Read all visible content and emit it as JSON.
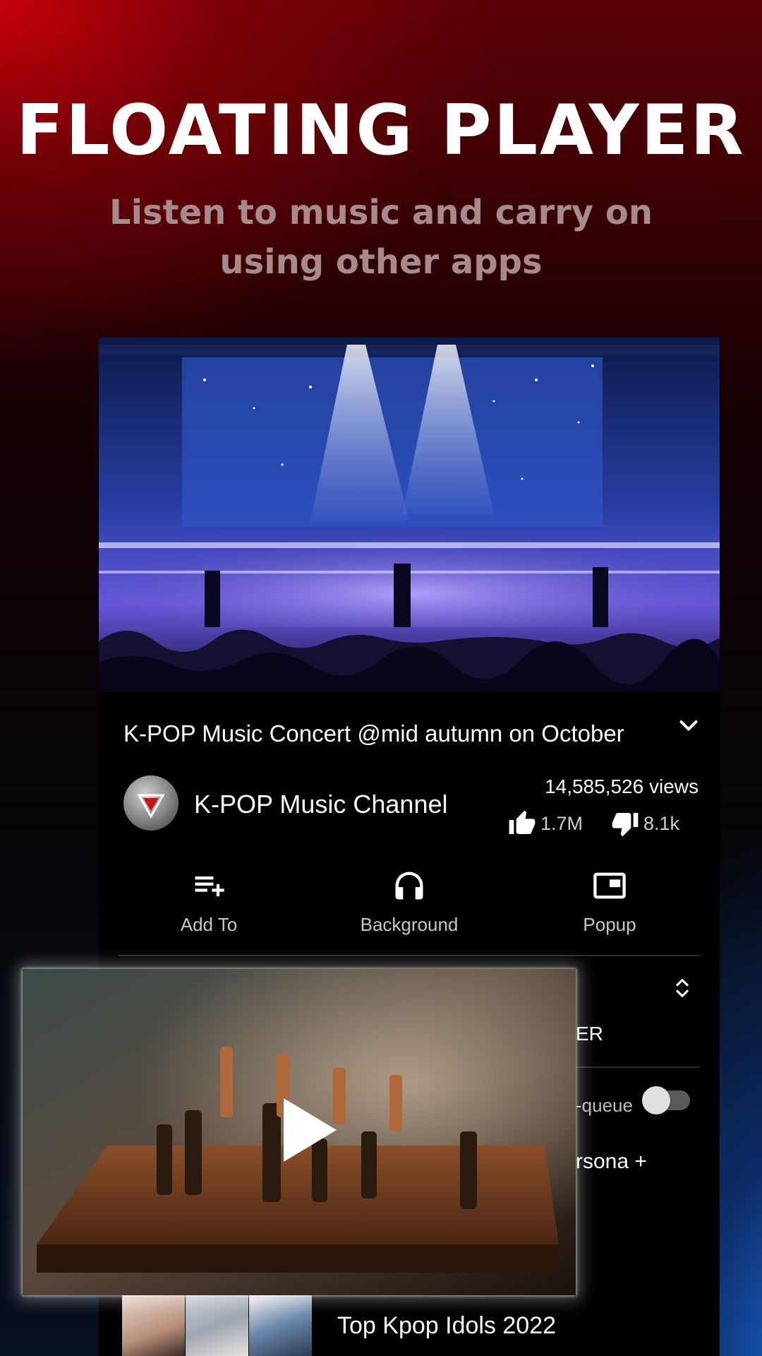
{
  "promo": {
    "title": "FLOATING PLAYER",
    "subtitle": "Listen to music and carry on using other apps"
  },
  "video": {
    "title": "K-POP Music Concert @mid autumn on October",
    "channel": "K-POP Music Channel",
    "views": "14,585,526 views",
    "likes": "1.7M",
    "dislikes": "8.1k"
  },
  "actions": [
    {
      "label": "Add To",
      "icon": "playlist-add-icon"
    },
    {
      "label": "Background",
      "icon": "headphones-icon"
    },
    {
      "label": "Popup",
      "icon": "picture-in-picture-icon"
    }
  ],
  "queue_peek": {
    "header_fragment": "ER",
    "autoqueue_fragment": "-queue",
    "autoqueue_enabled": false,
    "item_fragment": "rsona +"
  },
  "playlist": {
    "title": "Top Kpop Idols 2022"
  },
  "mini_player": {
    "state": "paused",
    "icon": "play-icon"
  },
  "colors": {
    "accent_red": "#c4000a",
    "accent_blue": "#1d6fe0",
    "card_bg": "#000000",
    "subtitle": "#a78a8c"
  }
}
